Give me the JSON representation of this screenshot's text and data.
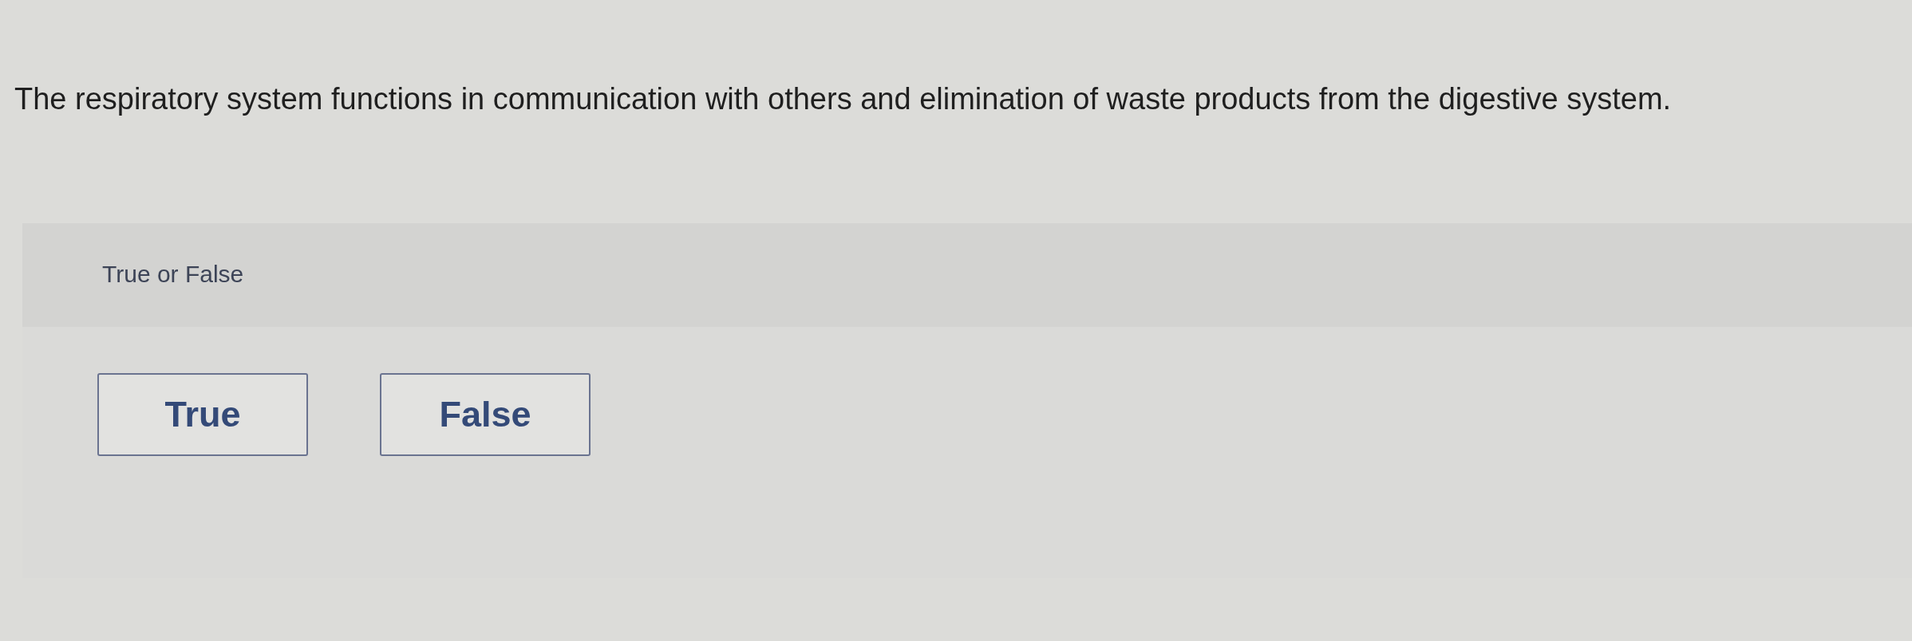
{
  "question": {
    "text": "The respiratory system functions in communication with others and elimination of waste products from the digestive system."
  },
  "answer_panel": {
    "prompt": "True or False",
    "options": [
      {
        "label": "True",
        "selected": false
      },
      {
        "label": "False",
        "selected": false
      }
    ]
  }
}
